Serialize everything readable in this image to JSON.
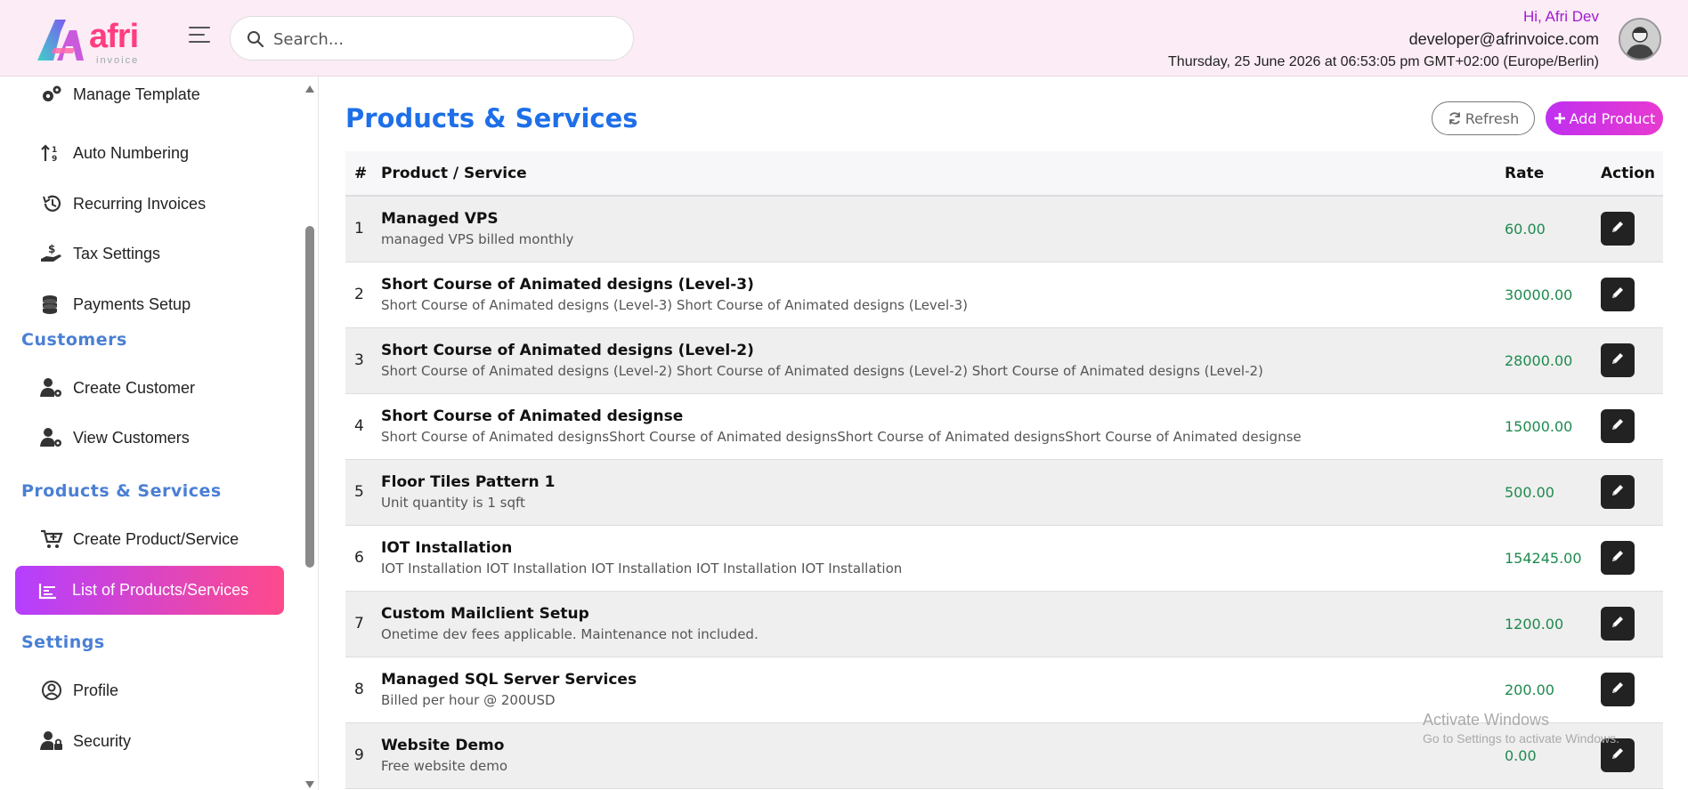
{
  "header": {
    "logo_text": "afri",
    "logo_subtext": "invoice",
    "search_placeholder": "Search...",
    "greeting": "Hi, Afri Dev",
    "email": "developer@afrinvoice.com",
    "datetime": "Thursday, 25 June 2026 at 06:53:05 pm GMT+02:00 (Europe/Berlin)"
  },
  "sidebar": {
    "items_top": [
      {
        "label": "Manage Template",
        "icon": "gears-icon"
      },
      {
        "label": "Auto Numbering",
        "icon": "sort-numeric-icon"
      },
      {
        "label": "Recurring Invoices",
        "icon": "history-icon"
      },
      {
        "label": "Tax Settings",
        "icon": "hand-dollar-icon"
      },
      {
        "label": "Payments Setup",
        "icon": "coins-icon"
      }
    ],
    "section_customers": "Customers",
    "items_customers": [
      {
        "label": "Create Customer",
        "icon": "user-gear-icon"
      },
      {
        "label": "View Customers",
        "icon": "user-gear-icon"
      }
    ],
    "section_products": "Products & Services",
    "items_products": [
      {
        "label": "Create Product/Service",
        "icon": "cart-plus-icon"
      },
      {
        "label": "List of Products/Services",
        "icon": "chart-bars-icon",
        "active": true
      }
    ],
    "section_settings": "Settings",
    "items_settings": [
      {
        "label": "Profile",
        "icon": "user-circle-icon"
      },
      {
        "label": "Security",
        "icon": "user-lock-icon"
      }
    ]
  },
  "main": {
    "title": "Products & Services",
    "refresh_label": "Refresh",
    "add_label": "Add Product",
    "columns": [
      "#",
      "Product / Service",
      "Rate",
      "Action"
    ],
    "rows": [
      {
        "num": "1",
        "name": "Managed VPS",
        "desc": "managed VPS billed monthly",
        "rate": "60.00"
      },
      {
        "num": "2",
        "name": "Short Course of Animated designs (Level-3)",
        "desc": "Short Course of Animated designs (Level-3) Short Course of Animated designs (Level-3)",
        "rate": "30000.00"
      },
      {
        "num": "3",
        "name": "Short Course of Animated designs (Level-2)",
        "desc": "Short Course of Animated designs (Level-2) Short Course of Animated designs (Level-2) Short Course of Animated designs (Level-2)",
        "rate": "28000.00"
      },
      {
        "num": "4",
        "name": "Short Course of Animated designse",
        "desc": "Short Course of Animated designsShort Course of Animated designsShort Course of Animated designsShort Course of Animated designse",
        "rate": "15000.00"
      },
      {
        "num": "5",
        "name": "Floor Tiles Pattern 1",
        "desc": "Unit quantity is 1 sqft",
        "rate": "500.00"
      },
      {
        "num": "6",
        "name": "IOT Installation",
        "desc": "IOT Installation IOT Installation IOT Installation IOT Installation IOT Installation",
        "rate": "154245.00"
      },
      {
        "num": "7",
        "name": "Custom Mailclient Setup",
        "desc": "Onetime dev fees applicable. Maintenance not included.",
        "rate": "1200.00"
      },
      {
        "num": "8",
        "name": "Managed SQL Server Services",
        "desc": "Billed per hour @ 200USD",
        "rate": "200.00"
      },
      {
        "num": "9",
        "name": "Website Demo",
        "desc": "Free website demo",
        "rate": "0.00"
      }
    ]
  },
  "watermark": {
    "line1": "Activate Windows",
    "line2": "Go to Settings to activate Windows."
  },
  "colors": {
    "accent_blue": "#1e6fe8",
    "section_blue": "#4a7fd4",
    "active_gradient_start": "#b43fff",
    "active_gradient_end": "#ff4a8b",
    "rate_green": "#1e8a4e",
    "greeting_purple": "#a21bd1",
    "header_bg": "#fcecf6"
  }
}
